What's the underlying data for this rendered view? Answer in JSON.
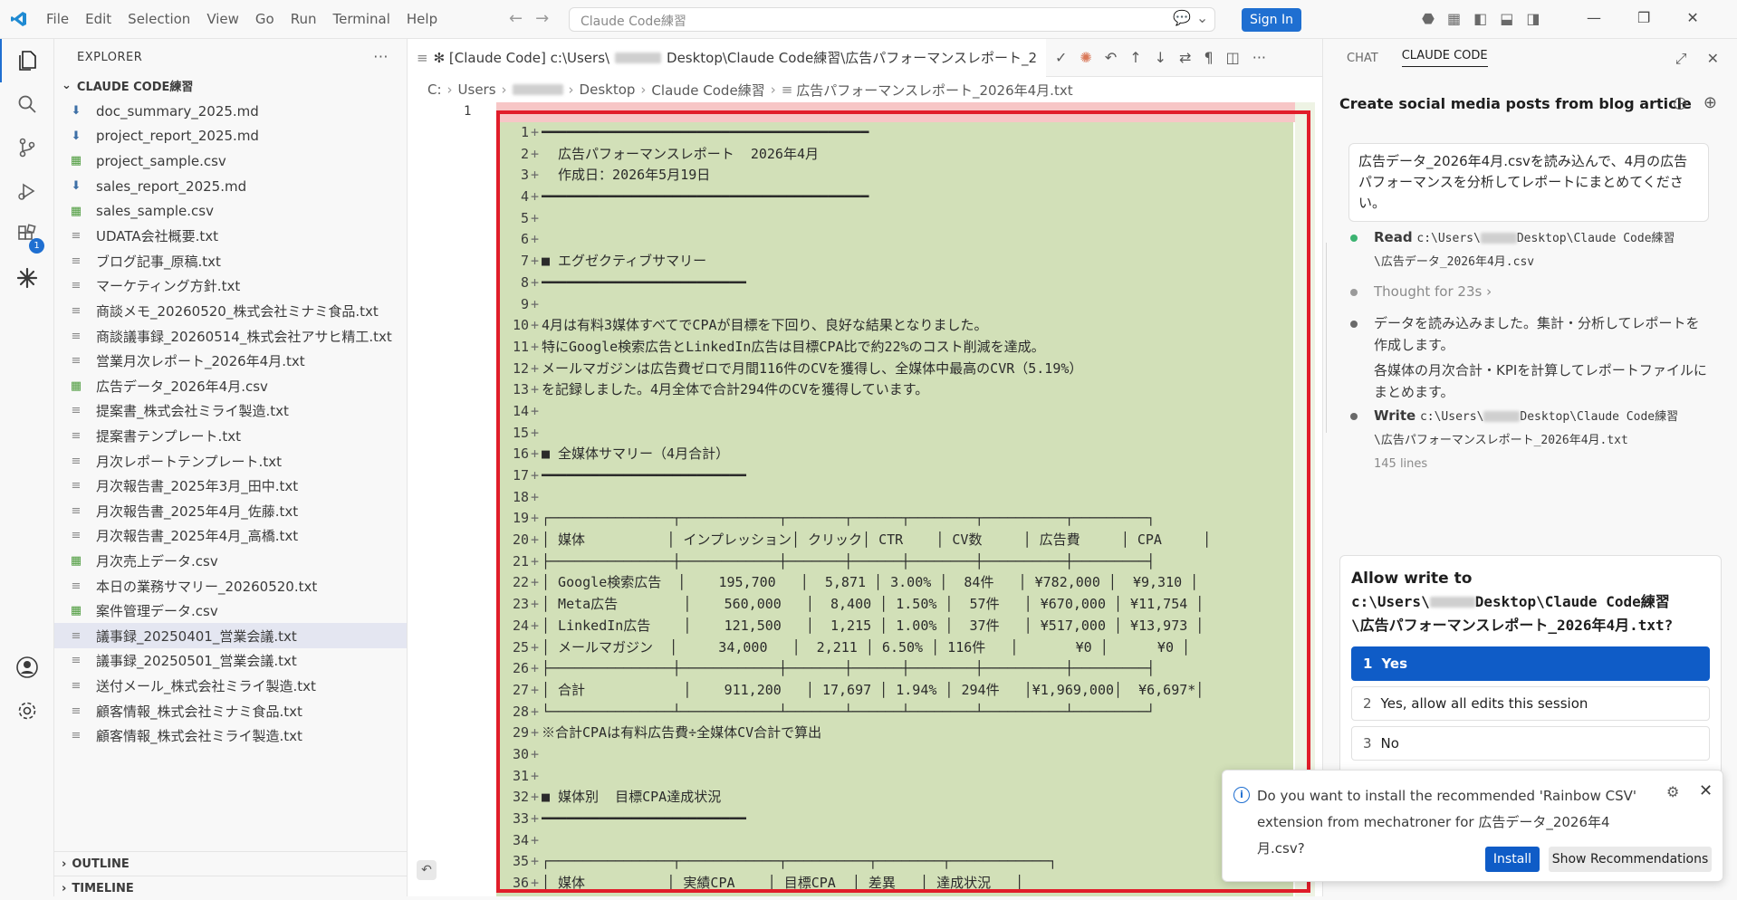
{
  "menu": [
    "File",
    "Edit",
    "Selection",
    "View",
    "Go",
    "Run",
    "Terminal",
    "Help"
  ],
  "command_center": "Claude Code練習",
  "signin_label": "Sign In",
  "explorer": {
    "header": "EXPLORER",
    "folder": "CLAUDE CODE練習",
    "files": [
      {
        "name": "doc_summary_2025.md",
        "type": "md"
      },
      {
        "name": "project_report_2025.md",
        "type": "md"
      },
      {
        "name": "project_sample.csv",
        "type": "csv"
      },
      {
        "name": "sales_report_2025.md",
        "type": "md"
      },
      {
        "name": "sales_sample.csv",
        "type": "csv"
      },
      {
        "name": "UDATA会社概要.txt",
        "type": "txt"
      },
      {
        "name": "ブログ記事_原稿.txt",
        "type": "txt"
      },
      {
        "name": "マーケティング方針.txt",
        "type": "txt"
      },
      {
        "name": "商談メモ_20260520_株式会社ミナミ食品.txt",
        "type": "txt"
      },
      {
        "name": "商談議事録_20260514_株式会社アサヒ精工.txt",
        "type": "txt"
      },
      {
        "name": "営業月次レポート_2026年4月.txt",
        "type": "txt"
      },
      {
        "name": "広告データ_2026年4月.csv",
        "type": "csv"
      },
      {
        "name": "提案書_株式会社ミライ製造.txt",
        "type": "txt"
      },
      {
        "name": "提案書テンプレート.txt",
        "type": "txt"
      },
      {
        "name": "月次レポートテンプレート.txt",
        "type": "txt"
      },
      {
        "name": "月次報告書_2025年3月_田中.txt",
        "type": "txt"
      },
      {
        "name": "月次報告書_2025年4月_佐藤.txt",
        "type": "txt"
      },
      {
        "name": "月次報告書_2025年4月_高橋.txt",
        "type": "txt"
      },
      {
        "name": "月次売上データ.csv",
        "type": "csv"
      },
      {
        "name": "本日の業務サマリー_20260520.txt",
        "type": "txt"
      },
      {
        "name": "案件管理データ.csv",
        "type": "csv"
      },
      {
        "name": "議事録_20250401_営業会議.txt",
        "type": "txt"
      },
      {
        "name": "議事録_20250501_営業会議.txt",
        "type": "txt"
      },
      {
        "name": "送付メール_株式会社ミライ製造.txt",
        "type": "txt"
      },
      {
        "name": "顧客情報_株式会社ミナミ食品.txt",
        "type": "txt"
      },
      {
        "name": "顧客情報_株式会社ミライ製造.txt",
        "type": "txt"
      }
    ],
    "outline": "OUTLINE",
    "timeline": "TIMELINE"
  },
  "editor": {
    "tab_title": "✻ [Claude Code] c:\\Users\\",
    "tab_title_rest": "Desktop\\Claude Code練習\\広告パフォーマンスレポート_2",
    "breadcrumb": [
      "C:",
      "Users",
      "Desktop",
      "Claude Code練習",
      "広告パフォーマンスレポート_2026年4月.txt"
    ],
    "original_line": "1",
    "diff_lines": [
      "━━━━━━━━━━━━━━━━━━━━━━━━━━━━━━━━━━━━━━━━",
      "  広告パフォーマンスレポート  2026年4月",
      "  作成日：2026年5月19日",
      "━━━━━━━━━━━━━━━━━━━━━━━━━━━━━━━━━━━━━━━━",
      "",
      "",
      "■ エグゼクティブサマリー",
      "━━━━━━━━━━━━━━━━━━━━━━━━━",
      "",
      "4月は有料3媒体すべてでCPAが目標を下回り、良好な結果となりました。",
      "特にGoogle検索広告とLinkedIn広告は目標CPA比で約22%のコスト削減を達成。",
      "メールマガジンは広告費ゼロで月間116件のCVを獲得し、全媒体中最高のCVR（5.19%）",
      "を記録しました。4月全体で合計294件のCVを獲得しています。",
      "",
      "",
      "■ 全媒体サマリー（4月合計）",
      "━━━━━━━━━━━━━━━━━━━━━━━━━",
      "",
      "┌───────────────┬────────────┬───────┬──────┬────────┬──────────┬─────────┐",
      "│ 媒体          │ インプレッション│ クリック│ CTR    │ CV数     │ 広告費     │ CPA     │",
      "├───────────────┼────────────┼───────┼──────┼────────┼──────────┼─────────┤",
      "│ Google検索広告  │    195,700   │  5,871 │ 3.00% │  84件   │ ¥782,000 │  ¥9,310 │",
      "│ Meta広告        │    560,000   │  8,400 │ 1.50% │  57件   │ ¥670,000 │ ¥11,754 │",
      "│ LinkedIn広告    │    121,500   │  1,215 │ 1.00% │  37件   │ ¥517,000 │ ¥13,973 │",
      "│ メールマガジン  │     34,000   │  2,211 │ 6.50% │ 116件   │       ¥0 │      ¥0 │",
      "├───────────────┼────────────┼───────┼──────┼────────┼──────────┼─────────┤",
      "│ 合計            │    911,200   │ 17,697 │ 1.94% │ 294件   │¥1,969,000│  ¥6,697*│",
      "└───────────────┴────────────┴───────┴──────┴────────┴──────────┴─────────┘",
      "※合計CPAは有料広告費÷全媒体CV合計で算出",
      "",
      "",
      "■ 媒体別  目標CPA達成状況",
      "━━━━━━━━━━━━━━━━━━━━━━━━━",
      "",
      "┌───────────────┬────────────┬──────────┬────────┬────────────┐",
      "│ 媒体          │ 実績CPA    │ 目標CPA  │ 差異   │ 達成状況   │"
    ]
  },
  "panel": {
    "tabs": [
      "CHAT",
      "CLAUDE CODE"
    ],
    "conversation_title": "Create social media posts from blog article",
    "user_message": "広告データ_2026年4月.csvを読み込んで、4月の広告パフォーマンスを分析してレポートにまとめてください。",
    "steps": {
      "read_label": "Read",
      "read_path_a": "c:\\Users\\",
      "read_path_b": "Desktop\\Claude Code練習",
      "read_path_c": "\\広告データ_2026年4月.csv",
      "thought": "Thought for 23s",
      "message_1": "データを読み込みました。集計・分析してレポートを作成します。",
      "message_2": "各媒体の月次合計・KPIを計算してレポートファイルにまとめます。",
      "write_label": "Write",
      "write_path_a": "c:\\Users\\",
      "write_path_b": "Desktop\\Claude Code練習",
      "write_path_c": "\\広告パフォーマンスレポート_2026年4月.txt",
      "write_meta": "145 lines"
    },
    "allow": {
      "title": "Allow write to",
      "path_a": "c:\\Users\\",
      "path_b": "Desktop\\Claude Code練習",
      "path_c": "\\広告パフォーマンスレポート_2026年4月.txt?",
      "options": [
        {
          "num": "1",
          "label": "Yes"
        },
        {
          "num": "2",
          "label": "Yes, allow all edits this session"
        },
        {
          "num": "3",
          "label": "No"
        }
      ]
    }
  },
  "toast": {
    "message": "Do you want to install the recommended 'Rainbow CSV' extension from mechatroner for 広告データ_2026年4月.csv?",
    "install": "Install",
    "recommendations": "Show Recommendations"
  },
  "colors": {
    "accent": "#1f6fd1",
    "diff_added": "#d2e0b8",
    "diff_removed": "#f7c6c6",
    "highlight_frame": "#e11d2a"
  }
}
